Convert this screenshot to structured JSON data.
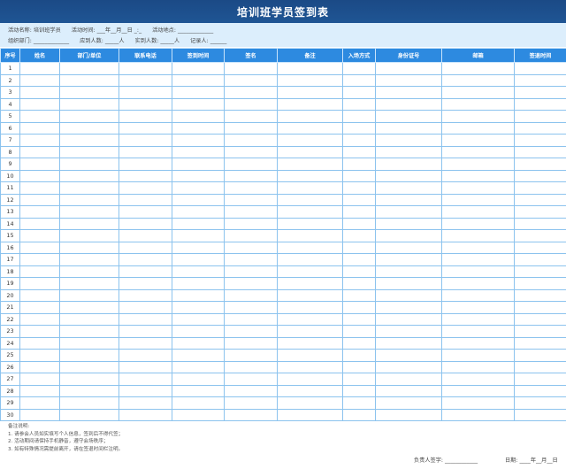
{
  "title": "培训班学员签到表",
  "info": {
    "row1": [
      {
        "label": "活动名称:",
        "value": "培训班学员"
      },
      {
        "label": "活动时间:",
        "value": "___年__月__日  _:_"
      },
      {
        "label": "活动地点:",
        "value": "_____________"
      }
    ],
    "row2": [
      {
        "label": "组织部门:",
        "value": "_____________"
      },
      {
        "label": "应到人数:",
        "value": "_____人"
      },
      {
        "label": "实到人数:",
        "value": "_____人"
      },
      {
        "label": "记录人:",
        "value": "______"
      }
    ]
  },
  "table": {
    "headers": [
      "序号",
      "姓名",
      "部门/单位",
      "联系电话",
      "签到时间",
      "签名",
      "备注",
      "入场方式",
      "身份证号",
      "邮箱",
      "签退时间"
    ],
    "rows": [
      "1",
      "2",
      "3",
      "4",
      "5",
      "6",
      "7",
      "8",
      "9",
      "10",
      "11",
      "12",
      "13",
      "14",
      "15",
      "16",
      "17",
      "18",
      "19",
      "20",
      "21",
      "22",
      "23",
      "24",
      "25",
      "26",
      "27",
      "28",
      "29",
      "30"
    ]
  },
  "notes": {
    "title": "备注说明:",
    "items": [
      "1. 请参会人员如实填写个人信息，签到后不得代签；",
      "2. 活动期间请保持手机静音，遵守会场秩序；",
      "3. 如有特殊情况需提前离开，请在签退时间栏注明。"
    ]
  },
  "footer": {
    "signature_label": "负责人签字:",
    "signature_value": "____________",
    "date_label": "日期:",
    "date_value": "____年__月__日"
  },
  "colors": {
    "title_bg": "#1b4a86",
    "info_bg": "#dceefc",
    "header_bg": "#2d8ae0",
    "grid_line": "#8cc3ee"
  }
}
